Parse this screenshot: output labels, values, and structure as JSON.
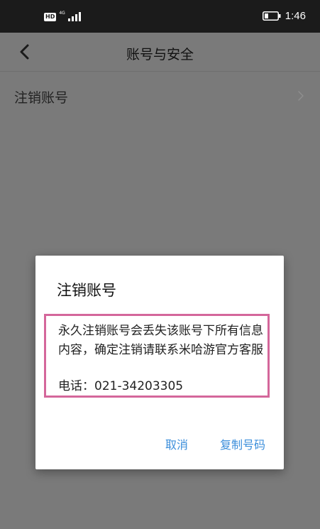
{
  "status_bar": {
    "hd_badge": "HD",
    "network": "4G",
    "time": "1:46"
  },
  "header": {
    "title": "账号与安全"
  },
  "list": {
    "items": [
      {
        "label": "注销账号"
      }
    ]
  },
  "dialog": {
    "title": "注销账号",
    "message": "永久注销账号会丢失该账号下所有信息内容，确定注销请联系米哈游官方客服",
    "phone": "电话：021-34203305",
    "cancel_label": "取消",
    "copy_label": "复制号码"
  },
  "colors": {
    "accent": "#3b8edb",
    "highlight_border": "#d4679b",
    "status_bar": "#1b1b1b",
    "overlay_bg": "#7a7a7a"
  },
  "icons": {
    "back": "chevron-left-icon",
    "list_arrow": "chevron-right-icon",
    "signal": "signal-icon",
    "battery": "battery-icon"
  }
}
